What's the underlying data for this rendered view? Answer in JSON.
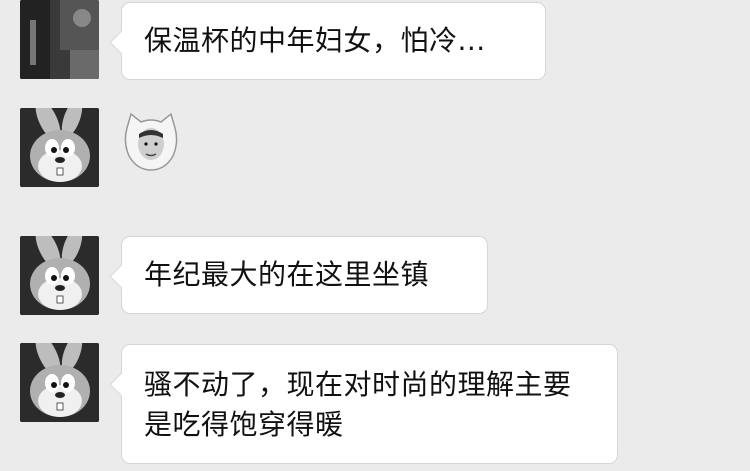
{
  "messages": [
    {
      "type": "text",
      "avatar": "street-photo-avatar",
      "text": "保温杯的中年妇女，怕冷..."
    },
    {
      "type": "sticker",
      "avatar": "bugs-bunny-avatar",
      "sticker": "cat-face-emoji-sticker"
    },
    {
      "type": "text",
      "avatar": "bugs-bunny-avatar",
      "text": "年纪最大的在这里坐镇"
    },
    {
      "type": "text",
      "avatar": "bugs-bunny-avatar",
      "text": "骚不动了，现在对时尚的理解主要是吃得饱穿得暖"
    }
  ]
}
